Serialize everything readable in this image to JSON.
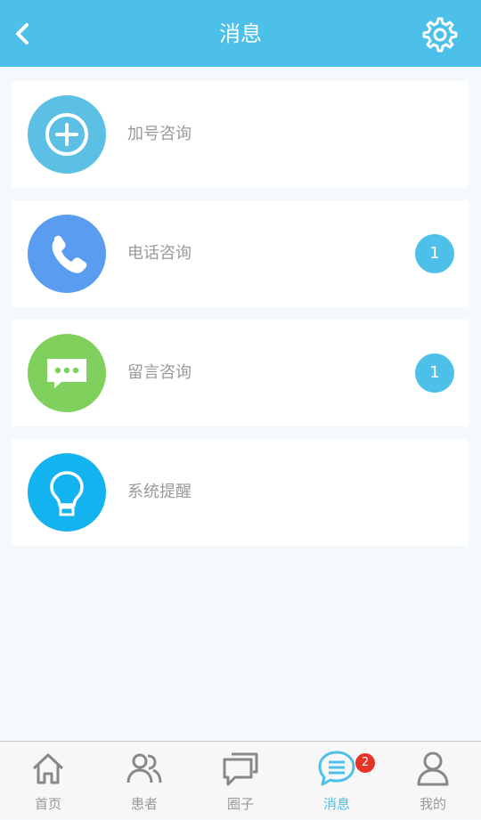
{
  "header": {
    "title": "消息"
  },
  "items": [
    {
      "label": "加号咨询",
      "icon": "plus-circle-icon",
      "color": "#5bc0e3"
    },
    {
      "label": "电话咨询",
      "icon": "phone-icon",
      "color": "#5a9cf0",
      "badge": "1"
    },
    {
      "label": "留言咨询",
      "icon": "chat-bubble-icon",
      "color": "#7fd05c",
      "badge": "1"
    },
    {
      "label": "系统提醒",
      "icon": "lightbulb-icon",
      "color": "#12b3ee"
    }
  ],
  "tabbar": {
    "tabs": [
      {
        "label": "首页",
        "icon": "home-icon"
      },
      {
        "label": "患者",
        "icon": "people-icon"
      },
      {
        "label": "圈子",
        "icon": "chat-icon"
      },
      {
        "label": "消息",
        "icon": "message-icon",
        "badge": "2",
        "active": true
      },
      {
        "label": "我的",
        "icon": "user-icon"
      }
    ]
  },
  "colors": {
    "accent": "#4cc0e8",
    "badge": "#e53327"
  }
}
